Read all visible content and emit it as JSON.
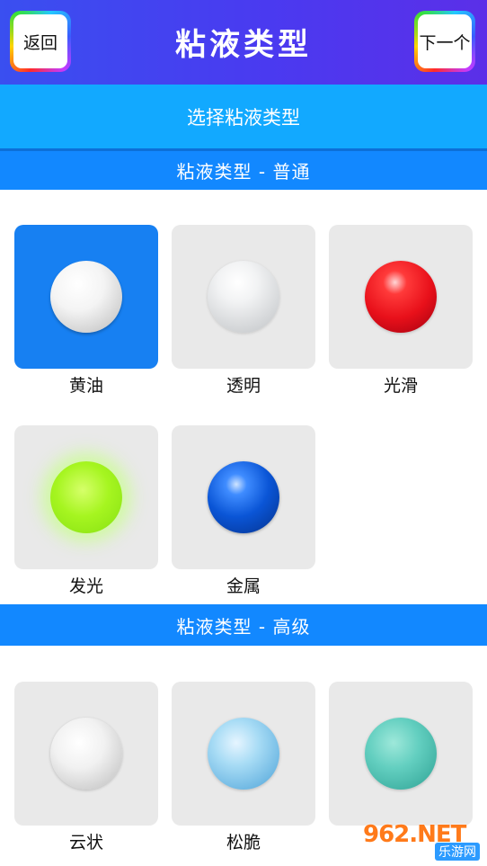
{
  "header": {
    "back_label": "返回",
    "title": "粘液类型",
    "next_label": "下一个"
  },
  "subheader": "选择粘液类型",
  "sections": [
    {
      "title": "粘液类型 - 普通",
      "items": [
        {
          "label": "黄油",
          "selected": true
        },
        {
          "label": "透明",
          "selected": false
        },
        {
          "label": "光滑",
          "selected": false
        },
        {
          "label": "发光",
          "selected": false
        },
        {
          "label": "金属",
          "selected": false
        }
      ]
    },
    {
      "title": "粘液类型 - 高级",
      "items": [
        {
          "label": "云状",
          "selected": false
        },
        {
          "label": "松脆",
          "selected": false
        },
        {
          "label": "",
          "selected": false
        }
      ]
    }
  ],
  "watermark": {
    "text": "962.NET",
    "sub": "乐游网"
  },
  "colors": {
    "header_gradient": [
      "#3a4ff0",
      "#5b2fe8"
    ],
    "subheader": "#12a9ff",
    "section_bar": "#1288ff",
    "selected_tile": "#1780f2",
    "tile": "#e9e9e9"
  }
}
